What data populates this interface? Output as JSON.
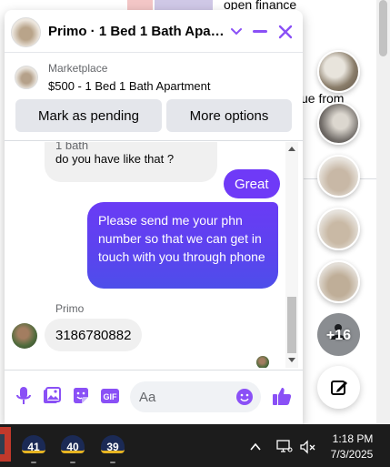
{
  "background": {
    "text_top": "open finance",
    "text_mid": "ue from"
  },
  "chat": {
    "title": "Primo · 1 Bed 1 Bath Apart…",
    "marketplace": {
      "source": "Marketplace",
      "listing": "$500 - 1 Bed 1 Bath Apartment",
      "mark_pending_label": "Mark as pending",
      "more_options_label": "More options"
    },
    "messages": {
      "prev_line1": "1 bath",
      "prev_line2": "do you have like that ?",
      "great": "Great",
      "long": "Please send me your phn number so that we can get in touch with you through phone",
      "sender": "Primo",
      "phone": "3186780882"
    },
    "composer": {
      "placeholder": "Aa",
      "gif_label": "GIF"
    },
    "accent_color": "#6f3af7"
  },
  "chatheads": {
    "more_label": "+16"
  },
  "taskbar": {
    "apps": [
      "41",
      "40",
      "39"
    ],
    "time": "1:18 PM",
    "date": "7/3/2025"
  },
  "icons": {
    "header": [
      "chevron-down-icon",
      "minimize-icon",
      "close-icon"
    ],
    "composer": [
      "microphone-icon",
      "photo-icon",
      "sticker-icon",
      "gif-icon",
      "emoji-icon",
      "thumbs-up-icon"
    ],
    "tray": [
      "chevron-up-icon",
      "display-icon",
      "volume-muted-icon"
    ]
  }
}
